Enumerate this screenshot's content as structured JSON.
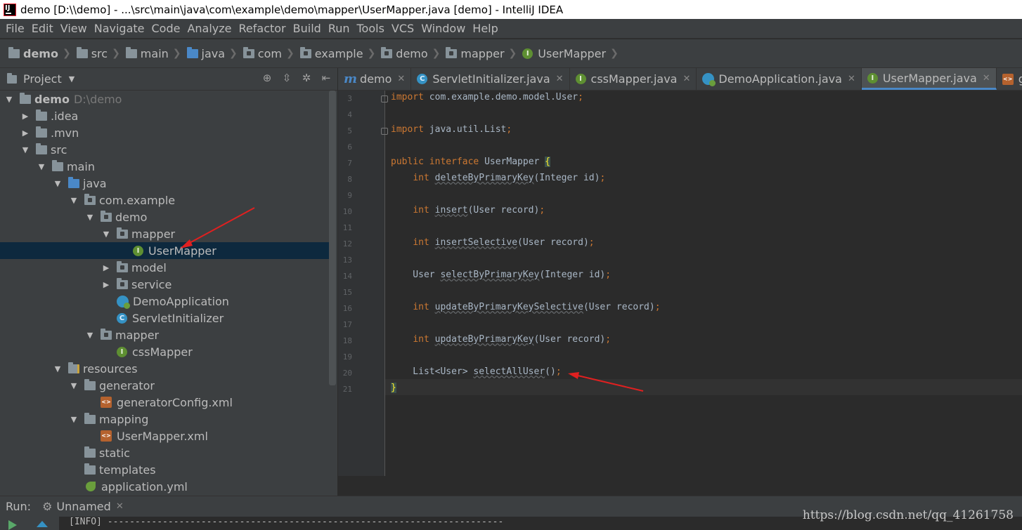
{
  "window": {
    "title": "demo [D:\\\\demo] - ...\\src\\main\\java\\com\\example\\demo\\mapper\\UserMapper.java [demo] - IntelliJ IDEA"
  },
  "menu": [
    "File",
    "Edit",
    "View",
    "Navigate",
    "Code",
    "Analyze",
    "Refactor",
    "Build",
    "Run",
    "Tools",
    "VCS",
    "Window",
    "Help"
  ],
  "breadcrumb": [
    "demo",
    "src",
    "main",
    "java",
    "com",
    "example",
    "demo",
    "mapper",
    "UserMapper"
  ],
  "project_panel": {
    "title": "Project",
    "tree": [
      {
        "label": "demo",
        "extra": "D:\\demo",
        "depth": 0,
        "expanded": true,
        "icon": "project-folder-icon"
      },
      {
        "label": ".idea",
        "depth": 1,
        "expanded": false,
        "icon": "folder-icon"
      },
      {
        "label": ".mvn",
        "depth": 1,
        "expanded": false,
        "icon": "folder-icon"
      },
      {
        "label": "src",
        "depth": 1,
        "expanded": true,
        "icon": "folder-icon"
      },
      {
        "label": "main",
        "depth": 2,
        "expanded": true,
        "icon": "folder-icon"
      },
      {
        "label": "java",
        "depth": 3,
        "expanded": true,
        "icon": "source-folder-icon"
      },
      {
        "label": "com.example",
        "depth": 4,
        "expanded": true,
        "icon": "package-icon"
      },
      {
        "label": "demo",
        "depth": 5,
        "expanded": true,
        "icon": "package-icon"
      },
      {
        "label": "mapper",
        "depth": 6,
        "expanded": true,
        "icon": "package-icon"
      },
      {
        "label": "UserMapper",
        "depth": 7,
        "icon": "interface-icon",
        "selected": true
      },
      {
        "label": "model",
        "depth": 6,
        "expanded": false,
        "icon": "package-icon"
      },
      {
        "label": "service",
        "depth": 6,
        "expanded": false,
        "icon": "package-icon"
      },
      {
        "label": "DemoApplication",
        "depth": 6,
        "icon": "spring-boot-class-icon"
      },
      {
        "label": "ServletInitializer",
        "depth": 6,
        "icon": "class-icon"
      },
      {
        "label": "mapper",
        "depth": 5,
        "expanded": true,
        "icon": "package-icon"
      },
      {
        "label": "cssMapper",
        "depth": 6,
        "icon": "interface-icon"
      },
      {
        "label": "resources",
        "depth": 3,
        "expanded": true,
        "icon": "resources-folder-icon"
      },
      {
        "label": "generator",
        "depth": 4,
        "expanded": true,
        "icon": "folder-icon"
      },
      {
        "label": "generatorConfig.xml",
        "depth": 5,
        "icon": "xml-file-icon"
      },
      {
        "label": "mapping",
        "depth": 4,
        "expanded": true,
        "icon": "folder-icon"
      },
      {
        "label": "UserMapper.xml",
        "depth": 5,
        "icon": "xml-file-icon"
      },
      {
        "label": "static",
        "depth": 4,
        "icon": "folder-icon"
      },
      {
        "label": "templates",
        "depth": 4,
        "icon": "folder-icon"
      },
      {
        "label": "application.yml",
        "depth": 4,
        "icon": "yaml-file-icon"
      }
    ]
  },
  "tabs": [
    {
      "label": "demo",
      "icon": "maven-icon",
      "active": false
    },
    {
      "label": "ServletInitializer.java",
      "icon": "class-icon",
      "active": false
    },
    {
      "label": "cssMapper.java",
      "icon": "interface-icon",
      "active": false
    },
    {
      "label": "DemoApplication.java",
      "icon": "spring-boot-class-icon",
      "active": false
    },
    {
      "label": "UserMapper.java",
      "icon": "interface-icon",
      "active": true
    },
    {
      "label": "generato",
      "icon": "xml-file-icon",
      "active": false
    }
  ],
  "editor": {
    "line_numbers": [
      "3",
      "4",
      "5",
      "6",
      "7",
      "8",
      "9",
      "10",
      "11",
      "12",
      "13",
      "14",
      "15",
      "16",
      "17",
      "18",
      "19",
      "20",
      "21"
    ],
    "lines": [
      "import com.example.demo.model.User;",
      "",
      "import java.util.List;",
      "",
      "public interface UserMapper {",
      "    int deleteByPrimaryKey(Integer id);",
      "",
      "    int insert(User record);",
      "",
      "    int insertSelective(User record);",
      "",
      "    User selectByPrimaryKey(Integer id);",
      "",
      "    int updateByPrimaryKeySelective(User record);",
      "",
      "    int updateByPrimaryKey(User record);",
      "",
      "    List<User> selectAllUser();",
      "}"
    ]
  },
  "run_bar": {
    "label": "Run:",
    "config": "Unnamed"
  },
  "console": {
    "line": "[INFO] ------------------------------------------------------------------------"
  },
  "watermark": "https://blog.csdn.net/qq_41261758",
  "colors": {
    "keyword": "#cc7832",
    "text": "#a9b7c6",
    "annotation_arrow": "#e02020",
    "selection": "#0d293e"
  }
}
